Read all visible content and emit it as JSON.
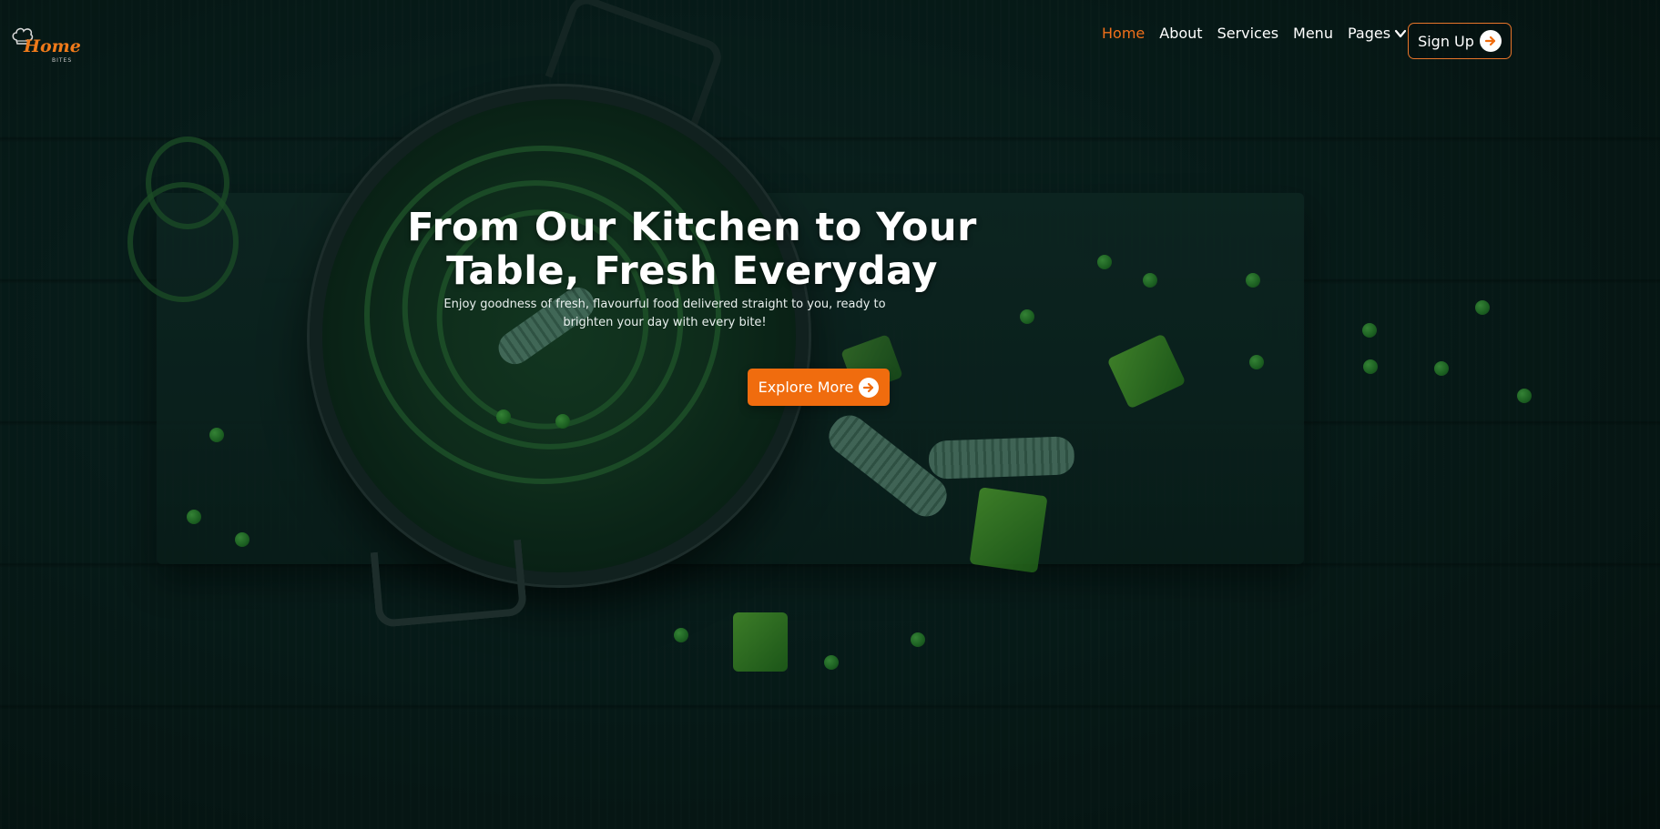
{
  "brand": {
    "logo_word": "Home",
    "logo_sub": "BITES",
    "accent_color": "#f06c0e"
  },
  "nav": {
    "items": [
      {
        "label": "Home",
        "active": true
      },
      {
        "label": "About",
        "active": false
      },
      {
        "label": "Services",
        "active": false
      },
      {
        "label": "Menu",
        "active": false
      },
      {
        "label": "Pages",
        "active": false,
        "has_dropdown": true
      }
    ],
    "signup_label": "Sign Up",
    "signup_icon": "arrow-right-circle-icon"
  },
  "hero": {
    "headline_line1": "From Our Kitchen to Your",
    "headline_line2": "Table, Fresh Everyday",
    "subtext_line1": "Enjoy goodness of fresh, flavourful food delivered straight to you, ready to",
    "subtext_line2": "brighten your day with every bite!",
    "cta_label": "Explore More",
    "cta_icon": "arrow-right-circle-icon"
  }
}
